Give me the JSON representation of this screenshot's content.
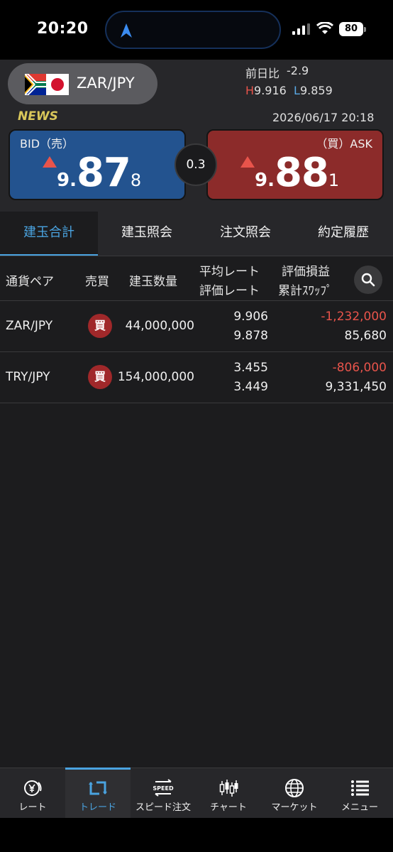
{
  "status_bar": {
    "time": "20:20",
    "battery": "80"
  },
  "header": {
    "pair": "ZAR/JPY",
    "prev_day_label": "前日比",
    "prev_day_value": "-2.9",
    "high_label": "H",
    "high_value": "9.916",
    "low_label": "L",
    "low_value": "9.859",
    "news_label": "NEWS",
    "datetime": "2026/06/17 20:18"
  },
  "quote": {
    "bid_label": "BID（売）",
    "bid_big1": "9.",
    "bid_big2": "87",
    "bid_small": "8",
    "ask_label": "（買）ASK",
    "ask_big1": "9.",
    "ask_big2": "88",
    "ask_small": "1",
    "spread": "0.3"
  },
  "tabs": [
    {
      "label": "建玉合計",
      "active": true
    },
    {
      "label": "建玉照会",
      "active": false
    },
    {
      "label": "注文照会",
      "active": false
    },
    {
      "label": "約定履歴",
      "active": false
    }
  ],
  "table": {
    "headers": {
      "pair": "通貨ペア",
      "side": "売買",
      "qty": "建玉数量",
      "rate_top": "平均レート",
      "rate_bottom": "評価レート",
      "pl_top": "評価損益",
      "pl_bottom": "累計ｽﾜｯﾌﾟ"
    },
    "rows": [
      {
        "pair": "ZAR/JPY",
        "side": "買",
        "qty": "44,000,000",
        "avg_rate": "9.906",
        "eval_rate": "9.878",
        "pl": "-1,232,000",
        "swap": "85,680"
      },
      {
        "pair": "TRY/JPY",
        "side": "買",
        "qty": "154,000,000",
        "avg_rate": "3.455",
        "eval_rate": "3.449",
        "pl": "-806,000",
        "swap": "9,331,450"
      }
    ]
  },
  "bottom_nav": [
    {
      "label": "レート",
      "icon": "yen-rate-icon",
      "active": false
    },
    {
      "label": "トレード",
      "icon": "trade-arrows-icon",
      "active": true
    },
    {
      "label": "スピード注文",
      "icon": "speed-order-icon",
      "active": false
    },
    {
      "label": "チャート",
      "icon": "candlestick-chart-icon",
      "active": false
    },
    {
      "label": "マーケット",
      "icon": "globe-icon",
      "active": false
    },
    {
      "label": "メニュー",
      "icon": "menu-list-icon",
      "active": false
    }
  ],
  "colors": {
    "accent": "#4aa3e0",
    "bid": "#23538f",
    "ask": "#8c2b2a",
    "negative": "#e8544b",
    "news": "#d9c75a"
  }
}
